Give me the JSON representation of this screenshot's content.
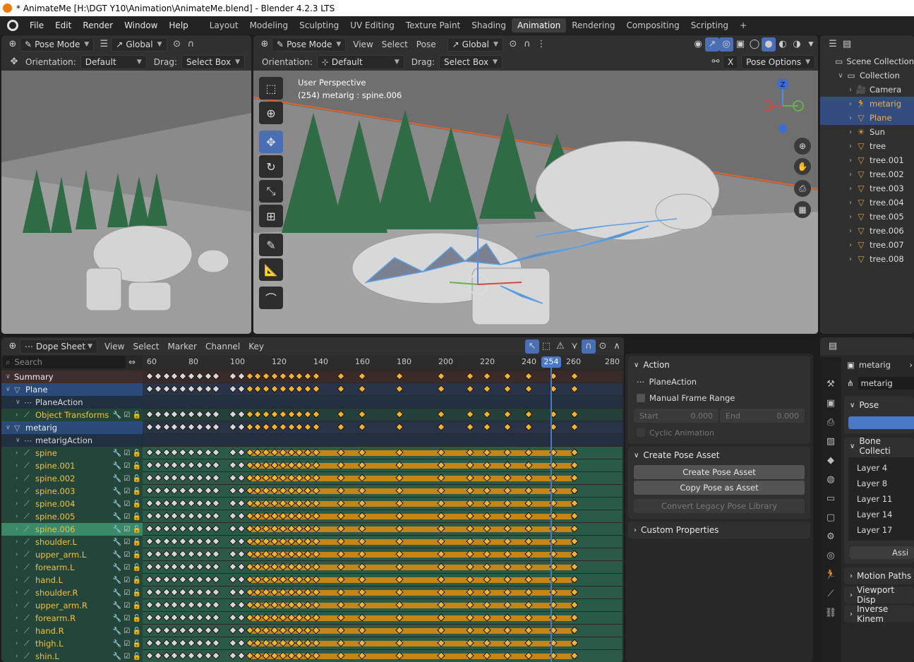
{
  "window_title": "* AnimateMe [H:\\DGT Y10\\Animation\\AnimateMe.blend] - Blender 4.2.3 LTS",
  "menu": [
    "File",
    "Edit",
    "Render",
    "Window",
    "Help"
  ],
  "workspace_tabs": [
    "Layout",
    "Modeling",
    "Sculpting",
    "UV Editing",
    "Texture Paint",
    "Shading",
    "Animation",
    "Rendering",
    "Compositing",
    "Scripting"
  ],
  "active_tab": "Animation",
  "left_viewport": {
    "mode": "Pose Mode",
    "transform": "Global",
    "orientation_label": "Orientation:",
    "orientation_value": "Default",
    "drag_label": "Drag:",
    "drag_value": "Select Box"
  },
  "main_viewport": {
    "mode": "Pose Mode",
    "menus": [
      "View",
      "Select",
      "Pose"
    ],
    "transform": "Global",
    "orientation_label": "Orientation:",
    "orientation_value": "Default",
    "drag_label": "Drag:",
    "drag_value": "Select Box",
    "x_mirror": "X",
    "pose_options": "Pose Options",
    "overlay_line1": "User Perspective",
    "overlay_line2": "(254) metarig : spine.006",
    "gizmo_z": "Z"
  },
  "outliner": {
    "rows": [
      {
        "label": "Scene Collection",
        "icon": "collection-icon",
        "indent": 0,
        "sel": false
      },
      {
        "label": "Collection",
        "icon": "collection-icon",
        "indent": 1,
        "sel": false
      },
      {
        "label": "Camera",
        "icon": "camera-icon",
        "indent": 2,
        "sel": false
      },
      {
        "label": "metarig",
        "icon": "armature-icon",
        "indent": 2,
        "sel": true
      },
      {
        "label": "Plane",
        "icon": "mesh-icon",
        "indent": 2,
        "sel": true
      },
      {
        "label": "Sun",
        "icon": "light-icon",
        "indent": 2,
        "sel": false
      },
      {
        "label": "tree",
        "icon": "mesh-icon",
        "indent": 2,
        "sel": false
      },
      {
        "label": "tree.001",
        "icon": "mesh-icon",
        "indent": 2,
        "sel": false
      },
      {
        "label": "tree.002",
        "icon": "mesh-icon",
        "indent": 2,
        "sel": false
      },
      {
        "label": "tree.003",
        "icon": "mesh-icon",
        "indent": 2,
        "sel": false
      },
      {
        "label": "tree.004",
        "icon": "mesh-icon",
        "indent": 2,
        "sel": false
      },
      {
        "label": "tree.005",
        "icon": "mesh-icon",
        "indent": 2,
        "sel": false
      },
      {
        "label": "tree.006",
        "icon": "mesh-icon",
        "indent": 2,
        "sel": false
      },
      {
        "label": "tree.007",
        "icon": "mesh-icon",
        "indent": 2,
        "sel": false
      },
      {
        "label": "tree.008",
        "icon": "mesh-icon",
        "indent": 2,
        "sel": false
      }
    ]
  },
  "dopesheet": {
    "mode": "Dope Sheet",
    "menus": [
      "View",
      "Select",
      "Marker",
      "Channel",
      "Key"
    ],
    "search_placeholder": "Search",
    "frame_ticks": [
      "60",
      "80",
      "100",
      "120",
      "140",
      "160",
      "180",
      "200",
      "220",
      "240",
      "260",
      "280"
    ],
    "current_frame": "254",
    "channels": [
      {
        "label": "Summary",
        "kind": "summary"
      },
      {
        "label": "Plane",
        "kind": "object"
      },
      {
        "label": "PlaneAction",
        "kind": "action"
      },
      {
        "label": "Object Transforms",
        "kind": "group"
      },
      {
        "label": "metarig",
        "kind": "object"
      },
      {
        "label": "metarigAction",
        "kind": "action"
      },
      {
        "label": "spine",
        "kind": "bone"
      },
      {
        "label": "spine.001",
        "kind": "bone"
      },
      {
        "label": "spine.002",
        "kind": "bone"
      },
      {
        "label": "spine.003",
        "kind": "bone"
      },
      {
        "label": "spine.004",
        "kind": "bone"
      },
      {
        "label": "spine.005",
        "kind": "bone"
      },
      {
        "label": "spine.006",
        "kind": "bone-sel"
      },
      {
        "label": "shoulder.L",
        "kind": "bone"
      },
      {
        "label": "upper_arm.L",
        "kind": "bone"
      },
      {
        "label": "forearm.L",
        "kind": "bone"
      },
      {
        "label": "hand.L",
        "kind": "bone"
      },
      {
        "label": "shoulder.R",
        "kind": "bone"
      },
      {
        "label": "upper_arm.R",
        "kind": "bone"
      },
      {
        "label": "forearm.R",
        "kind": "bone"
      },
      {
        "label": "hand.R",
        "kind": "bone"
      },
      {
        "label": "thigh.L",
        "kind": "bone"
      },
      {
        "label": "shin.L",
        "kind": "bone"
      }
    ]
  },
  "action_panel": {
    "action_header": "Action",
    "action_name": "PlaneAction",
    "manual_frame_range": "Manual Frame Range",
    "start_label": "Start",
    "start_value": "0.000",
    "end_label": "End",
    "end_value": "0.000",
    "cyclic": "Cyclic Animation",
    "create_pose_header": "Create Pose Asset",
    "create_pose_btn": "Create Pose Asset",
    "copy_pose_btn": "Copy Pose as Asset",
    "convert_legacy_btn": "Convert Legacy Pose Library",
    "custom_props": "Custom Properties"
  },
  "properties": {
    "object_name": "metarig",
    "armature_name": "metarig",
    "pose_header": "Pose",
    "bone_collections_header": "Bone Collecti",
    "layers": [
      "Layer 4",
      "Layer 8",
      "Layer 11",
      "Layer 14",
      "Layer 17"
    ],
    "assign_btn": "Assi",
    "motion_paths": "Motion Paths",
    "viewport_display": "Viewport Disp",
    "inverse_kinematics": "Inverse Kinem"
  }
}
